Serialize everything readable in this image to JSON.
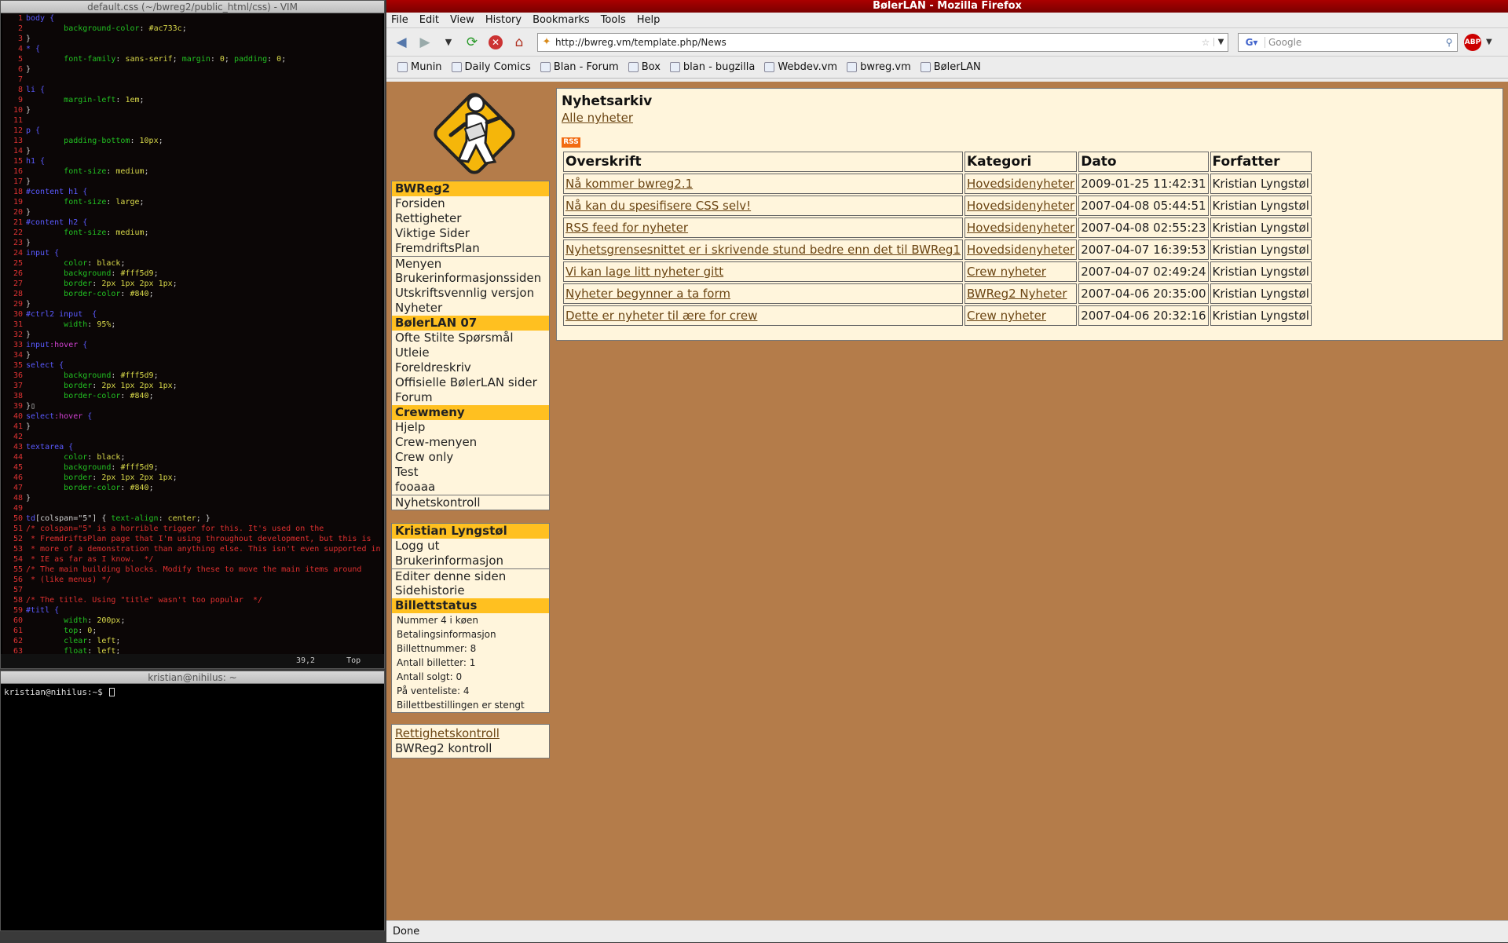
{
  "vim": {
    "title": "default.css (~/bwreg2/public_html/css) - VIM",
    "status_pos": "39,2",
    "status_scroll": "Top",
    "lines": [
      {
        "n": "1",
        "parts": [
          [
            "sel",
            "body {"
          ]
        ]
      },
      {
        "n": "2",
        "parts": [
          [
            "pn",
            "        "
          ],
          [
            "prop",
            "background-color"
          ],
          [
            "pn",
            ": "
          ],
          [
            "val",
            "#ac733c"
          ],
          [
            "pn",
            ";"
          ]
        ]
      },
      {
        "n": "3",
        "parts": [
          [
            "pn",
            "}"
          ]
        ]
      },
      {
        "n": "4",
        "parts": [
          [
            "sel",
            "* {"
          ]
        ]
      },
      {
        "n": "5",
        "parts": [
          [
            "pn",
            "        "
          ],
          [
            "prop",
            "font-family"
          ],
          [
            "pn",
            ": "
          ],
          [
            "val",
            "sans-serif"
          ],
          [
            "pn",
            "; "
          ],
          [
            "prop",
            "margin"
          ],
          [
            "pn",
            ": "
          ],
          [
            "val",
            "0"
          ],
          [
            "pn",
            "; "
          ],
          [
            "prop",
            "padding"
          ],
          [
            "pn",
            ": "
          ],
          [
            "val",
            "0"
          ],
          [
            "pn",
            ";"
          ]
        ]
      },
      {
        "n": "6",
        "parts": [
          [
            "pn",
            "}"
          ]
        ]
      },
      {
        "n": "7",
        "parts": []
      },
      {
        "n": "8",
        "parts": [
          [
            "sel",
            "li {"
          ]
        ]
      },
      {
        "n": "9",
        "parts": [
          [
            "pn",
            "        "
          ],
          [
            "prop",
            "margin-left"
          ],
          [
            "pn",
            ": "
          ],
          [
            "val",
            "1em"
          ],
          [
            "pn",
            ";"
          ]
        ]
      },
      {
        "n": "10",
        "parts": [
          [
            "pn",
            "}"
          ]
        ]
      },
      {
        "n": "11",
        "parts": []
      },
      {
        "n": "12",
        "parts": [
          [
            "sel",
            "p {"
          ]
        ]
      },
      {
        "n": "13",
        "parts": [
          [
            "pn",
            "        "
          ],
          [
            "prop",
            "padding-bottom"
          ],
          [
            "pn",
            ": "
          ],
          [
            "val",
            "10px"
          ],
          [
            "pn",
            ";"
          ]
        ]
      },
      {
        "n": "14",
        "parts": [
          [
            "pn",
            "}"
          ]
        ]
      },
      {
        "n": "15",
        "parts": [
          [
            "sel",
            "h1 {"
          ]
        ]
      },
      {
        "n": "16",
        "parts": [
          [
            "pn",
            "        "
          ],
          [
            "prop",
            "font-size"
          ],
          [
            "pn",
            ": "
          ],
          [
            "val",
            "medium"
          ],
          [
            "pn",
            ";"
          ]
        ]
      },
      {
        "n": "17",
        "parts": [
          [
            "pn",
            "}"
          ]
        ]
      },
      {
        "n": "18",
        "parts": [
          [
            "sel",
            "#content h1 {"
          ]
        ]
      },
      {
        "n": "19",
        "parts": [
          [
            "pn",
            "        "
          ],
          [
            "prop",
            "font-size"
          ],
          [
            "pn",
            ": "
          ],
          [
            "val",
            "large"
          ],
          [
            "pn",
            ";"
          ]
        ]
      },
      {
        "n": "20",
        "parts": [
          [
            "pn",
            "}"
          ]
        ]
      },
      {
        "n": "21",
        "parts": [
          [
            "sel",
            "#content h2 {"
          ]
        ]
      },
      {
        "n": "22",
        "parts": [
          [
            "pn",
            "        "
          ],
          [
            "prop",
            "font-size"
          ],
          [
            "pn",
            ": "
          ],
          [
            "val",
            "medium"
          ],
          [
            "pn",
            ";"
          ]
        ]
      },
      {
        "n": "23",
        "parts": [
          [
            "pn",
            "}"
          ]
        ]
      },
      {
        "n": "24",
        "parts": [
          [
            "sel",
            "input {"
          ]
        ]
      },
      {
        "n": "25",
        "parts": [
          [
            "pn",
            "        "
          ],
          [
            "prop",
            "color"
          ],
          [
            "pn",
            ": "
          ],
          [
            "val",
            "black"
          ],
          [
            "pn",
            ";"
          ]
        ]
      },
      {
        "n": "26",
        "parts": [
          [
            "pn",
            "        "
          ],
          [
            "prop",
            "background"
          ],
          [
            "pn",
            ": "
          ],
          [
            "val",
            "#fff5d9"
          ],
          [
            "pn",
            ";"
          ]
        ]
      },
      {
        "n": "27",
        "parts": [
          [
            "pn",
            "        "
          ],
          [
            "prop",
            "border"
          ],
          [
            "pn",
            ": "
          ],
          [
            "val",
            "2px 1px 2px 1px"
          ],
          [
            "pn",
            ";"
          ]
        ]
      },
      {
        "n": "28",
        "parts": [
          [
            "pn",
            "        "
          ],
          [
            "prop",
            "border-color"
          ],
          [
            "pn",
            ": "
          ],
          [
            "val",
            "#840"
          ],
          [
            "pn",
            ";"
          ]
        ]
      },
      {
        "n": "29",
        "parts": [
          [
            "pn",
            "}"
          ]
        ]
      },
      {
        "n": "30",
        "parts": [
          [
            "sel",
            "#ctrl2 input  {"
          ]
        ]
      },
      {
        "n": "31",
        "parts": [
          [
            "pn",
            "        "
          ],
          [
            "prop",
            "width"
          ],
          [
            "pn",
            ": "
          ],
          [
            "val",
            "95%"
          ],
          [
            "pn",
            ";"
          ]
        ]
      },
      {
        "n": "32",
        "parts": [
          [
            "pn",
            "}"
          ]
        ]
      },
      {
        "n": "33",
        "parts": [
          [
            "sel",
            "input"
          ],
          [
            "pk",
            ":hover"
          ],
          [
            "sel",
            " {"
          ]
        ]
      },
      {
        "n": "34",
        "parts": [
          [
            "pn",
            "}"
          ]
        ]
      },
      {
        "n": "35",
        "parts": [
          [
            "sel",
            "select {"
          ]
        ]
      },
      {
        "n": "36",
        "parts": [
          [
            "pn",
            "        "
          ],
          [
            "prop",
            "background"
          ],
          [
            "pn",
            ": "
          ],
          [
            "val",
            "#fff5d9"
          ],
          [
            "pn",
            ";"
          ]
        ]
      },
      {
        "n": "37",
        "parts": [
          [
            "pn",
            "        "
          ],
          [
            "prop",
            "border"
          ],
          [
            "pn",
            ": "
          ],
          [
            "val",
            "2px 1px 2px 1px"
          ],
          [
            "pn",
            ";"
          ]
        ]
      },
      {
        "n": "38",
        "parts": [
          [
            "pn",
            "        "
          ],
          [
            "prop",
            "border-color"
          ],
          [
            "pn",
            ": "
          ],
          [
            "val",
            "#840"
          ],
          [
            "pn",
            ";"
          ]
        ]
      },
      {
        "n": "39",
        "parts": [
          [
            "pn",
            "}▯"
          ]
        ]
      },
      {
        "n": "40",
        "parts": [
          [
            "sel",
            "select"
          ],
          [
            "pk",
            ":hover"
          ],
          [
            "sel",
            " {"
          ]
        ]
      },
      {
        "n": "41",
        "parts": [
          [
            "pn",
            "}"
          ]
        ]
      },
      {
        "n": "42",
        "parts": []
      },
      {
        "n": "43",
        "parts": [
          [
            "sel",
            "textarea {"
          ]
        ]
      },
      {
        "n": "44",
        "parts": [
          [
            "pn",
            "        "
          ],
          [
            "prop",
            "color"
          ],
          [
            "pn",
            ": "
          ],
          [
            "val",
            "black"
          ],
          [
            "pn",
            ";"
          ]
        ]
      },
      {
        "n": "45",
        "parts": [
          [
            "pn",
            "        "
          ],
          [
            "prop",
            "background"
          ],
          [
            "pn",
            ": "
          ],
          [
            "val",
            "#fff5d9"
          ],
          [
            "pn",
            ";"
          ]
        ]
      },
      {
        "n": "46",
        "parts": [
          [
            "pn",
            "        "
          ],
          [
            "prop",
            "border"
          ],
          [
            "pn",
            ": "
          ],
          [
            "val",
            "2px 1px 2px 1px"
          ],
          [
            "pn",
            ";"
          ]
        ]
      },
      {
        "n": "47",
        "parts": [
          [
            "pn",
            "        "
          ],
          [
            "prop",
            "border-color"
          ],
          [
            "pn",
            ": "
          ],
          [
            "val",
            "#840"
          ],
          [
            "pn",
            ";"
          ]
        ]
      },
      {
        "n": "48",
        "parts": [
          [
            "pn",
            "}"
          ]
        ]
      },
      {
        "n": "49",
        "parts": []
      },
      {
        "n": "50",
        "parts": [
          [
            "sel",
            "td"
          ],
          [
            "pn",
            "[colspan=\"5\"] { "
          ],
          [
            "prop",
            "text-align"
          ],
          [
            "pn",
            ": "
          ],
          [
            "val",
            "center"
          ],
          [
            "pn",
            "; }"
          ]
        ]
      },
      {
        "n": "51",
        "parts": [
          [
            "cmt",
            "/* colspan=\"5\" is a horrible trigger for this. It's used on the"
          ]
        ]
      },
      {
        "n": "52",
        "parts": [
          [
            "cmt",
            " * FremdriftsPlan page that I'm using throughout development, but this is"
          ]
        ]
      },
      {
        "n": "53",
        "parts": [
          [
            "cmt",
            " * more of a demonstration than anything else. This isn't even supported in"
          ]
        ]
      },
      {
        "n": "54",
        "parts": [
          [
            "cmt",
            " * IE as far as I know.  */"
          ]
        ]
      },
      {
        "n": "55",
        "parts": [
          [
            "cmt",
            "/* The main building blocks. Modify these to move the main items around"
          ]
        ]
      },
      {
        "n": "56",
        "parts": [
          [
            "cmt",
            " * (like menus) */"
          ]
        ]
      },
      {
        "n": "57",
        "parts": []
      },
      {
        "n": "58",
        "parts": [
          [
            "cmt",
            "/* The title. Using \"title\" wasn't too popular  */"
          ]
        ]
      },
      {
        "n": "59",
        "parts": [
          [
            "sel",
            "#titl {"
          ]
        ]
      },
      {
        "n": "60",
        "parts": [
          [
            "pn",
            "        "
          ],
          [
            "prop",
            "width"
          ],
          [
            "pn",
            ": "
          ],
          [
            "val",
            "200px"
          ],
          [
            "pn",
            ";"
          ]
        ]
      },
      {
        "n": "61",
        "parts": [
          [
            "pn",
            "        "
          ],
          [
            "prop",
            "top"
          ],
          [
            "pn",
            ": "
          ],
          [
            "val",
            "0"
          ],
          [
            "pn",
            ";"
          ]
        ]
      },
      {
        "n": "62",
        "parts": [
          [
            "pn",
            "        "
          ],
          [
            "prop",
            "clear"
          ],
          [
            "pn",
            ": "
          ],
          [
            "val",
            "left"
          ],
          [
            "pn",
            ";"
          ]
        ]
      },
      {
        "n": "63",
        "parts": [
          [
            "pn",
            "        "
          ],
          [
            "prop",
            "float"
          ],
          [
            "pn",
            ": "
          ],
          [
            "val",
            "left"
          ],
          [
            "pn",
            ";"
          ]
        ]
      }
    ]
  },
  "shell": {
    "title": "kristian@nihilus: ~",
    "prompt": "kristian@nihilus:~$ "
  },
  "firefox": {
    "title": "BølerLAN - Mozilla Firefox",
    "menu": [
      "File",
      "Edit",
      "View",
      "History",
      "Bookmarks",
      "Tools",
      "Help"
    ],
    "url": "http://bwreg.vm/template.php/News",
    "search_placeholder": "Google",
    "abp": "ABP",
    "bookmarks": [
      "Munin",
      "Daily Comics",
      "Blan - Forum",
      "Box",
      "blan - bugzilla",
      "Webdev.vm",
      "bwreg.vm",
      "BølerLAN"
    ],
    "status": "Done"
  },
  "sidebar": {
    "menu1": [
      {
        "type": "hd",
        "text": "BWReg2"
      },
      {
        "type": "it",
        "text": "Forsiden"
      },
      {
        "type": "it",
        "text": "Rettigheter"
      },
      {
        "type": "it",
        "text": "Viktige Sider"
      },
      {
        "type": "it",
        "text": "FremdriftsPlan"
      },
      {
        "type": "sep",
        "text": "Menyen"
      },
      {
        "type": "it",
        "text": "Brukerinformasjonssiden"
      },
      {
        "type": "it",
        "text": "Utskriftsvennlig versjon"
      },
      {
        "type": "it",
        "text": "Nyheter"
      },
      {
        "type": "hd",
        "text": "BølerLAN 07"
      },
      {
        "type": "it",
        "text": "Ofte Stilte Spørsmål"
      },
      {
        "type": "it",
        "text": "Utleie"
      },
      {
        "type": "it",
        "text": "Foreldreskriv"
      },
      {
        "type": "it",
        "text": "Offisielle BølerLAN sider"
      },
      {
        "type": "it",
        "text": "Forum"
      },
      {
        "type": "hd",
        "text": "Crewmeny"
      },
      {
        "type": "it",
        "text": "Hjelp"
      },
      {
        "type": "it",
        "text": "Crew-menyen"
      },
      {
        "type": "it",
        "text": "Crew only"
      },
      {
        "type": "it",
        "text": "Test"
      },
      {
        "type": "it",
        "text": "fooaaa"
      },
      {
        "type": "sep",
        "text": "Nyhetskontroll"
      }
    ],
    "menu2": [
      {
        "type": "hd",
        "text": "Kristian Lyngstøl"
      },
      {
        "type": "it",
        "text": "Logg ut"
      },
      {
        "type": "it",
        "text": "Brukerinformasjon"
      },
      {
        "type": "sep",
        "text": "Editer denne siden"
      },
      {
        "type": "it",
        "text": "Sidehistorie"
      },
      {
        "type": "hd",
        "text": "Billettstatus"
      },
      {
        "type": "sm",
        "text": "Nummer 4 i køen"
      },
      {
        "type": "sm",
        "text": "Betalingsinformasjon"
      },
      {
        "type": "sm",
        "text": "Billettnummer: 8"
      },
      {
        "type": "sm",
        "text": "Antall billetter: 1"
      },
      {
        "type": "sm",
        "text": "Antall solgt: 0"
      },
      {
        "type": "sm",
        "text": "På venteliste: 4"
      },
      {
        "type": "sm",
        "text": "Billettbestillingen er stengt"
      }
    ],
    "menu3": [
      {
        "type": "link",
        "text": "Rettighetskontroll"
      },
      {
        "type": "it",
        "text": "BWReg2 kontroll"
      }
    ]
  },
  "news": {
    "heading": "Nyhetsarkiv",
    "all_link": "Alle nyheter",
    "rss": "RSS",
    "columns": [
      "Overskrift",
      "Kategori",
      "Dato",
      "Forfatter"
    ],
    "rows": [
      [
        "Nå kommer bwreg2.1",
        "Hovedsidenyheter",
        "2009-01-25 11:42:31",
        "Kristian Lyngstøl"
      ],
      [
        "Nå kan du spesifisere CSS selv!",
        "Hovedsidenyheter",
        "2007-04-08 05:44:51",
        "Kristian Lyngstøl"
      ],
      [
        "RSS feed for nyheter",
        "Hovedsidenyheter",
        "2007-04-08 02:55:23",
        "Kristian Lyngstøl"
      ],
      [
        "Nyhetsgrensesnittet er i skrivende stund bedre enn det til BWReg1",
        "Hovedsidenyheter",
        "2007-04-07 16:39:53",
        "Kristian Lyngstøl"
      ],
      [
        "Vi kan lage litt nyheter gitt",
        "Crew nyheter",
        "2007-04-07 02:49:24",
        "Kristian Lyngstøl"
      ],
      [
        "Nyheter begynner a ta form",
        "BWReg2 Nyheter",
        "2007-04-06 20:35:00",
        "Kristian Lyngstøl"
      ],
      [
        "Dette er nyheter til ære for crew",
        "Crew nyheter",
        "2007-04-06 20:32:16",
        "Kristian Lyngstøl"
      ]
    ]
  }
}
